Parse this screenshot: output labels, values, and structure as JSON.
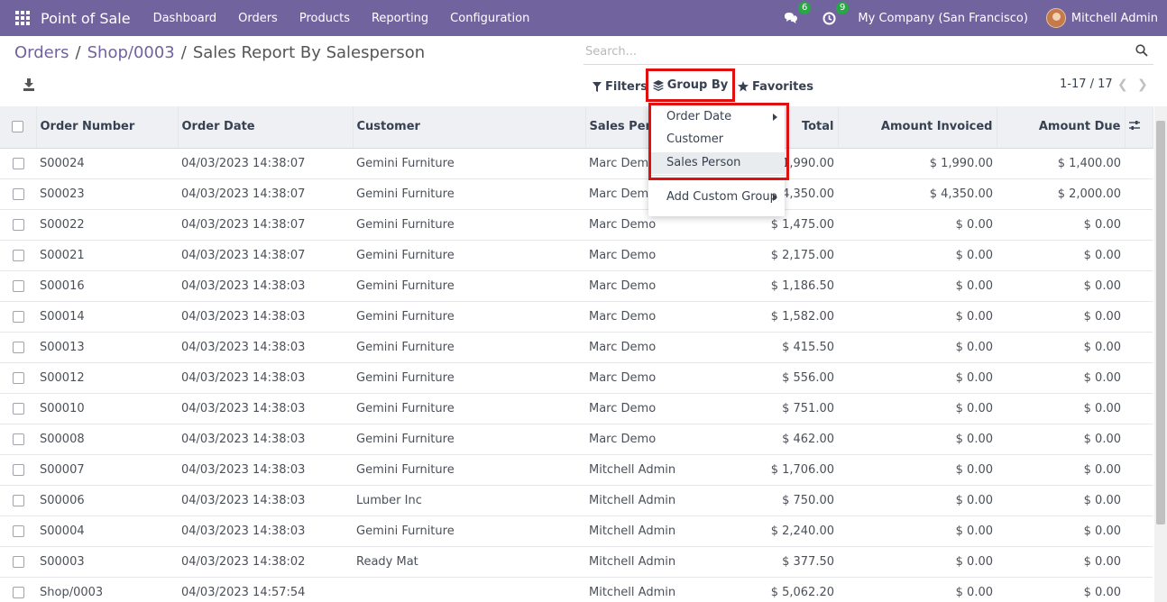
{
  "navbar": {
    "app_title": "Point of Sale",
    "menu": [
      "Dashboard",
      "Orders",
      "Products",
      "Reporting",
      "Configuration"
    ],
    "messages_count": "6",
    "activities_count": "9",
    "company": "My Company (San Francisco)",
    "user": "Mitchell Admin",
    "accent": "#71639e"
  },
  "breadcrumb": [
    "Orders",
    "Shop/0003",
    "Sales Report By Salesperson"
  ],
  "search": {
    "placeholder": "Search..."
  },
  "toolbar": {
    "filters": "Filters",
    "group_by": "Group By",
    "favorites": "Favorites",
    "pager": "1-17 / 17"
  },
  "dropdown": {
    "items": [
      "Order Date",
      "Customer",
      "Sales Person"
    ],
    "custom": "Add Custom Group"
  },
  "table": {
    "headers": [
      "Order Number",
      "Order Date",
      "Customer",
      "Sales Person",
      "Total",
      "Amount Invoiced",
      "Amount Due"
    ],
    "rows": [
      [
        "S00024",
        "04/03/2023 14:38:07",
        "Gemini Furniture",
        "Marc Demo",
        "$ 1,990.00",
        "$ 1,990.00",
        "$ 1,400.00"
      ],
      [
        "S00023",
        "04/03/2023 14:38:07",
        "Gemini Furniture",
        "Marc Demo",
        "$ 4,350.00",
        "$ 4,350.00",
        "$ 2,000.00"
      ],
      [
        "S00022",
        "04/03/2023 14:38:07",
        "Gemini Furniture",
        "Marc Demo",
        "$ 1,475.00",
        "$ 0.00",
        "$ 0.00"
      ],
      [
        "S00021",
        "04/03/2023 14:38:07",
        "Gemini Furniture",
        "Marc Demo",
        "$ 2,175.00",
        "$ 0.00",
        "$ 0.00"
      ],
      [
        "S00016",
        "04/03/2023 14:38:03",
        "Gemini Furniture",
        "Marc Demo",
        "$ 1,186.50",
        "$ 0.00",
        "$ 0.00"
      ],
      [
        "S00014",
        "04/03/2023 14:38:03",
        "Gemini Furniture",
        "Marc Demo",
        "$ 1,582.00",
        "$ 0.00",
        "$ 0.00"
      ],
      [
        "S00013",
        "04/03/2023 14:38:03",
        "Gemini Furniture",
        "Marc Demo",
        "$ 415.50",
        "$ 0.00",
        "$ 0.00"
      ],
      [
        "S00012",
        "04/03/2023 14:38:03",
        "Gemini Furniture",
        "Marc Demo",
        "$ 556.00",
        "$ 0.00",
        "$ 0.00"
      ],
      [
        "S00010",
        "04/03/2023 14:38:03",
        "Gemini Furniture",
        "Marc Demo",
        "$ 751.00",
        "$ 0.00",
        "$ 0.00"
      ],
      [
        "S00008",
        "04/03/2023 14:38:03",
        "Gemini Furniture",
        "Marc Demo",
        "$ 462.00",
        "$ 0.00",
        "$ 0.00"
      ],
      [
        "S00007",
        "04/03/2023 14:38:03",
        "Gemini Furniture",
        "Mitchell Admin",
        "$ 1,706.00",
        "$ 0.00",
        "$ 0.00"
      ],
      [
        "S00006",
        "04/03/2023 14:38:03",
        "Lumber Inc",
        "Mitchell Admin",
        "$ 750.00",
        "$ 0.00",
        "$ 0.00"
      ],
      [
        "S00004",
        "04/03/2023 14:38:03",
        "Gemini Furniture",
        "Mitchell Admin",
        "$ 2,240.00",
        "$ 0.00",
        "$ 0.00"
      ],
      [
        "S00003",
        "04/03/2023 14:38:02",
        "Ready Mat",
        "Mitchell Admin",
        "$ 377.50",
        "$ 0.00",
        "$ 0.00"
      ],
      [
        "Shop/0003",
        "04/03/2023 14:57:54",
        "",
        "Mitchell Admin",
        "$ 5,062.20",
        "$ 0.00",
        "$ 0.00"
      ]
    ]
  }
}
